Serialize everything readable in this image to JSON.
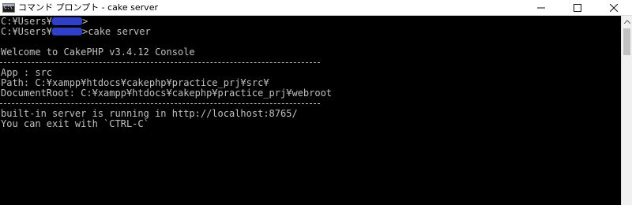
{
  "window": {
    "title": "コマンド プロンプト - cake  server",
    "icon": "cmd-console-icon",
    "controls": {
      "minimize_icon": "minimize-icon",
      "maximize_icon": "maximize-icon",
      "close_icon": "close-icon"
    }
  },
  "console": {
    "prompt1_prefix": "C:¥Users¥",
    "prompt1_suffix": ">",
    "prompt2_prefix": "C:¥Users¥",
    "prompt2_suffix": ">cake server",
    "welcome": "Welcome to CakePHP v3.4.12 Console",
    "app": "App : src",
    "path": "Path: C:¥xampp¥htdocs¥cakephp¥practice_prj¥src¥",
    "docroot": "DocumentRoot: C:¥xampp¥htdocs¥cakephp¥practice_prj¥webroot",
    "server_running": "built-in server is running in http://localhost:8765/",
    "exit_hint": "You can exit with `CTRL-C`"
  },
  "colors": {
    "console_bg": "#000000",
    "console_fg": "#c0c0c0",
    "redaction": "#2f3fc8"
  }
}
